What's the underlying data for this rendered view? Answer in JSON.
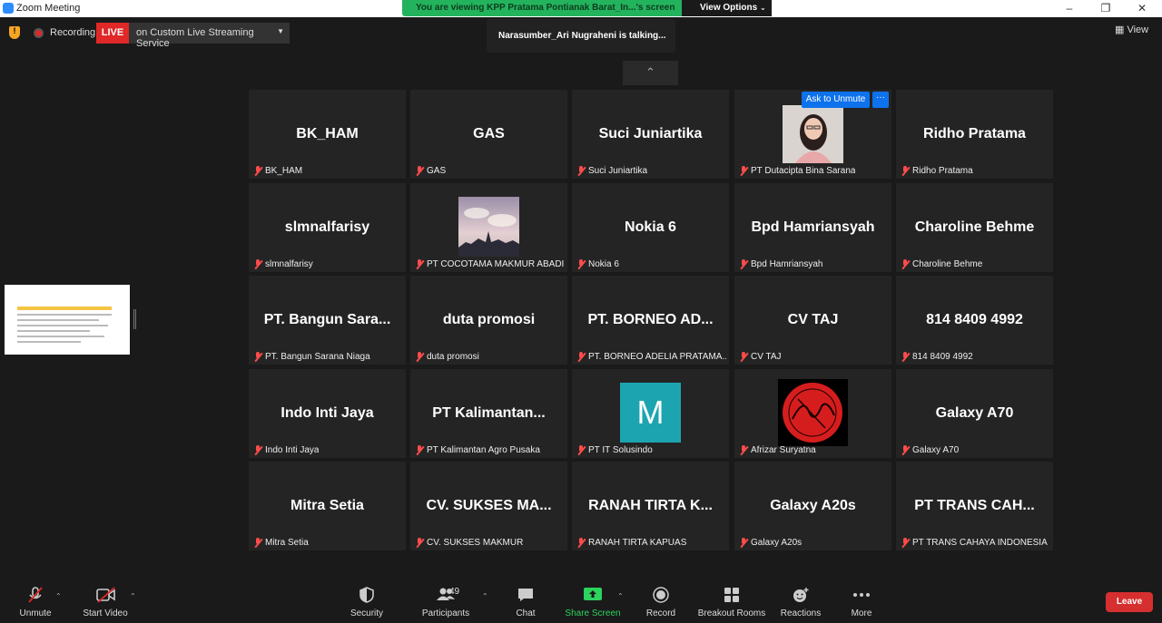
{
  "window": {
    "title": "Zoom Meeting"
  },
  "share_banner": {
    "text": "You are viewing KPP Pratama Pontianak Barat_In...'s screen",
    "view_options": "View Options"
  },
  "status": {
    "recording": "Recording",
    "live": "LIVE",
    "live_service": "on Custom Live Streaming Service"
  },
  "talking": "Narasumber_Ari Nugraheni is talking...",
  "view_button": "View",
  "ask_unmute": "Ask to Unmute",
  "more_dots": "···",
  "tiles": [
    {
      "name": "BK_HAM",
      "label": "BK_HAM"
    },
    {
      "name": "GAS",
      "label": "GAS"
    },
    {
      "name": "Suci Juniartika",
      "label": "Suci Juniartika"
    },
    {
      "name": "",
      "label": "PT Dutacipta Bina Sarana"
    },
    {
      "name": "Ridho Pratama",
      "label": "Ridho Pratama"
    },
    {
      "name": "slmnalfarisy",
      "label": "slmnalfarisy"
    },
    {
      "name": "",
      "label": "PT COCOTAMA MAKMUR ABADI"
    },
    {
      "name": "Nokia 6",
      "label": "Nokia 6"
    },
    {
      "name": "Bpd Hamriansyah",
      "label": "Bpd Hamriansyah"
    },
    {
      "name": "Charoline Behme",
      "label": "Charoline Behme"
    },
    {
      "name": "PT. Bangun Sara...",
      "label": "PT. Bangun Sarana Niaga"
    },
    {
      "name": "duta promosi",
      "label": "duta promosi"
    },
    {
      "name": "PT.  BORNEO  AD...",
      "label": "PT.  BORNEO ADELIA PRATAMA..."
    },
    {
      "name": "CV TAJ",
      "label": "CV TAJ"
    },
    {
      "name": "814 8409 4992",
      "label": "814 8409 4992"
    },
    {
      "name": "Indo Inti Jaya",
      "label": "Indo Inti Jaya"
    },
    {
      "name": "PT  Kalimantan...",
      "label": "PT Kalimantan Agro Pusaka"
    },
    {
      "name": "",
      "label": "PT IT Solusindo"
    },
    {
      "name": "",
      "label": "Afrizar Suryatna"
    },
    {
      "name": "Galaxy A70",
      "label": "Galaxy A70"
    },
    {
      "name": "Mitra Setia",
      "label": "Mitra Setia"
    },
    {
      "name": "CV.  SUKSES  MA...",
      "label": "CV. SUKSES MAKMUR"
    },
    {
      "name": "RANAH  TIRTA  K...",
      "label": "RANAH TIRTA KAPUAS"
    },
    {
      "name": "Galaxy A20s",
      "label": "Galaxy A20s"
    },
    {
      "name": "PT  TRANS  CAH...",
      "label": "PT TRANS CAHAYA INDONESIA"
    }
  ],
  "m_avatar_letter": "M",
  "toolbar": {
    "unmute": "Unmute",
    "start_video": "Start Video",
    "security": "Security",
    "participants": "Participants",
    "participants_count": "49",
    "chat": "Chat",
    "share_screen": "Share Screen",
    "record": "Record",
    "breakout_rooms": "Breakout Rooms",
    "reactions": "Reactions",
    "more": "More",
    "leave": "Leave"
  },
  "colors": {
    "accent_green": "#24b35d",
    "live_red": "#e02828",
    "zoom_blue": "#0e72ed",
    "leave_red": "#d62f2f"
  }
}
